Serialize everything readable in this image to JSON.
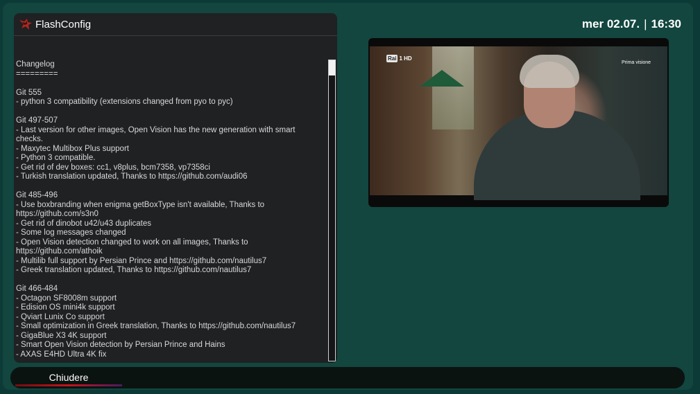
{
  "window": {
    "title": "FlashConfig"
  },
  "clock": {
    "date": "mer 02.07.",
    "separator": "|",
    "time": "16:30"
  },
  "changelog": {
    "lines": [
      "Changelog",
      "=========",
      "",
      "Git 555",
      "- python 3 compatibility (extensions changed from pyo to pyc)",
      "",
      "Git 497-507",
      "- Last version for other images, Open Vision has the new generation with smart checks.",
      "- Maxytec Multibox Plus support",
      "- Python 3 compatible.",
      "- Get rid of dev boxes: cc1, v8plus, bcm7358, vp7358ci",
      "- Turkish translation updated, Thanks to https://github.com/audi06",
      "",
      "Git 485-496",
      "- Use boxbranding when enigma getBoxType isn't available, Thanks to https://github.com/s3n0",
      "- Get rid of dinobot u42/u43 duplicates",
      "- Some log messages changed",
      "- Open Vision detection changed to work on all images, Thanks to https://github.com/athoik",
      "- Multilib full support by Persian Prince and https://github.com/nautilus7",
      "- Greek translation updated, Thanks to https://github.com/nautilus7",
      "",
      "Git 466-484",
      "- Octagon SF8008m support",
      "- Edision OS mini4k support",
      "- Qviart Lunix Co support",
      "- Small optimization in Greek translation, Thanks to https://github.com/nautilus7",
      "- GigaBlue X3 4K support",
      "- Smart Open Vision detection by Persian Prince and Hains",
      "- AXAS E4HD Ultra 4K fix"
    ]
  },
  "video": {
    "channel_logo": "Rai",
    "channel_number": "1 HD",
    "badge": "Prima visione"
  },
  "footer": {
    "close_label": "Chiudere"
  },
  "colors": {
    "background": "#12463f",
    "panel": "#1f2123",
    "accent_red": "#c4151b"
  },
  "icons": {
    "logo": "bird-logo-icon"
  }
}
